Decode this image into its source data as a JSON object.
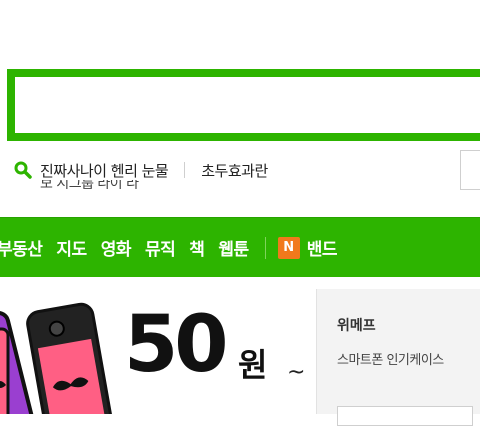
{
  "search": {
    "placeholder": ""
  },
  "trending": {
    "items": [
      "진짜사나이 헨리 눈물",
      "초두효과란"
    ],
    "ghost": "보 시그룹 라이 라"
  },
  "nav": {
    "items": [
      "부동산",
      "지도",
      "영화",
      "뮤직",
      "책",
      "웹툰"
    ],
    "band_icon": "N",
    "band_label": "밴드"
  },
  "banner": {
    "price": "50",
    "unit": "원",
    "tilde": "~"
  },
  "ad": {
    "title": "위메프",
    "subtitle": "스마트폰 인기케이스"
  },
  "colors": {
    "brand": "#2db400",
    "band": "#f1791c"
  }
}
